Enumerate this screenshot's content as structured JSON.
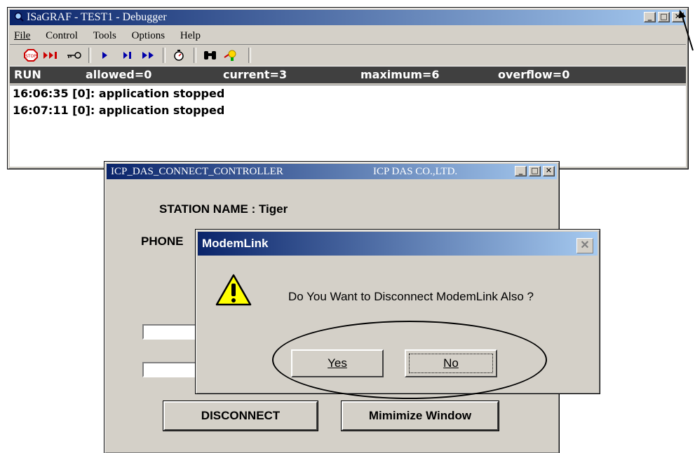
{
  "main_window": {
    "title": "ISaGRAF - TEST1 - Debugger",
    "menu": [
      "File",
      "Control",
      "Tools",
      "Options",
      "Help"
    ],
    "status": {
      "mode": "RUN",
      "allowed": "allowed=0",
      "current": "current=3",
      "maximum": "maximum=6",
      "overflow": "overflow=0"
    },
    "log": [
      "16:06:35 [0]: application stopped",
      "16:07:11 [0]: application stopped"
    ]
  },
  "icp_window": {
    "title": "ICP_DAS_CONNECT_CONTROLLER",
    "company": "ICP DAS CO.,LTD.",
    "station_label": "STATION NAME : Tiger",
    "phone_label": "PHONE",
    "disconnect_button": "DISCONNECT",
    "minimize_button": "Mimimize Window"
  },
  "dialog": {
    "title": "ModemLink",
    "message": "Do You Want to Disconnect ModemLink Also ?",
    "yes_button": "Yes",
    "no_button": "No"
  }
}
